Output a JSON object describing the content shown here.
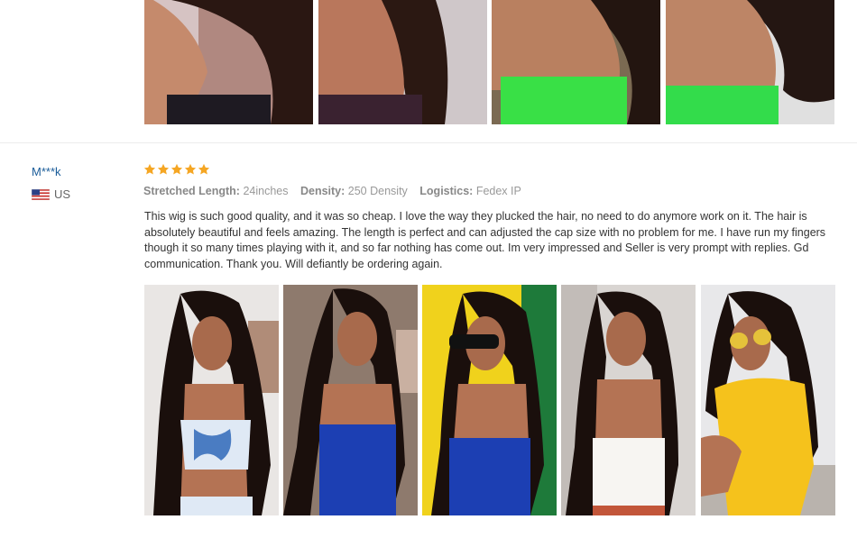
{
  "review": {
    "reviewer": "M***k",
    "country": "US",
    "rating": 5,
    "attributes": [
      {
        "key": "Stretched Length:",
        "value": "24inches"
      },
      {
        "key": "Density:",
        "value": "250 Density"
      },
      {
        "key": "Logistics:",
        "value": "Fedex IP"
      }
    ],
    "text": "This wig is such good quality, and it was so cheap. I love the way they plucked the hair, no need to do anymore work on it. The hair is absolutely beautiful and feels amazing. The length is perfect and can adjusted the cap size with no problem for me. I have run my fingers though it so many times playing with it, and so far nothing has come out. Im very impressed and Seller is very prompt with replies. Gd communication. Thank you. Will defiantly be ordering again."
  },
  "colors": {
    "reviewer_link": "#1a5c99",
    "star": "#f5a623",
    "text": "#333333",
    "muted": "#999999"
  }
}
